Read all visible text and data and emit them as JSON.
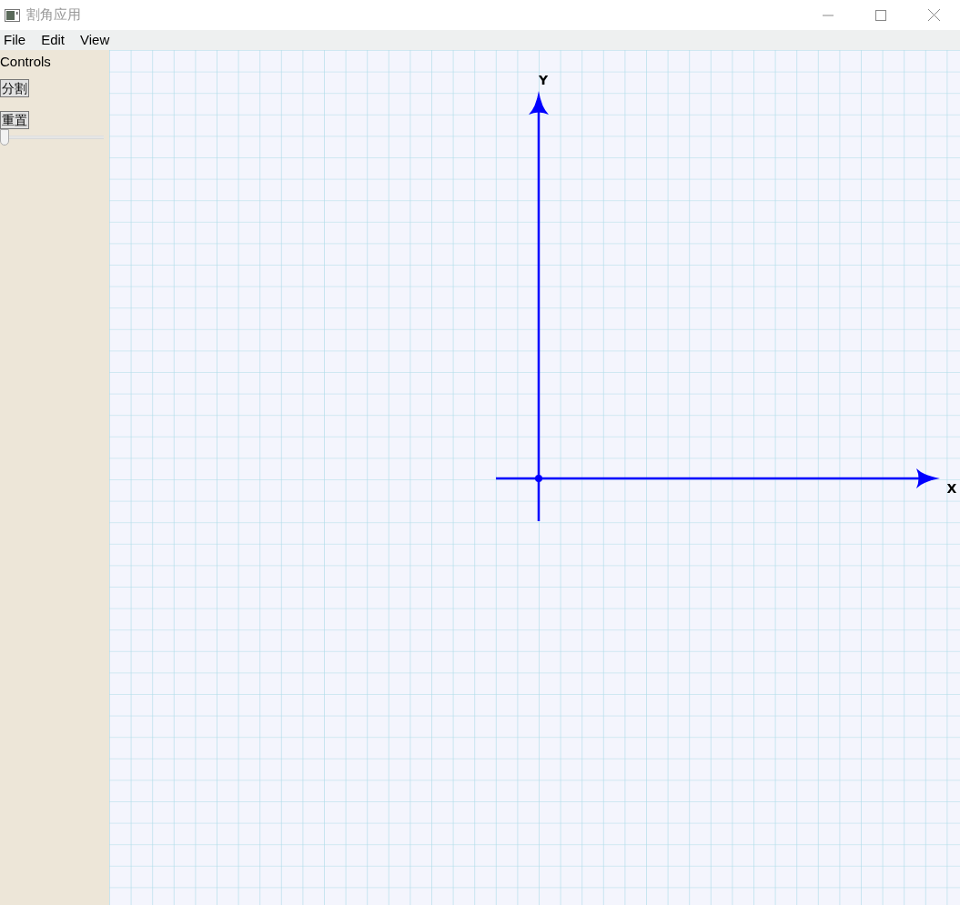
{
  "window": {
    "title": "割角应用"
  },
  "menu": [
    {
      "label": "File"
    },
    {
      "label": "Edit"
    },
    {
      "label": "View"
    }
  ],
  "sidebar": {
    "title": "Controls",
    "buttons": [
      {
        "label": "分割"
      },
      {
        "label": "重置"
      }
    ],
    "slider": {
      "level": 0
    }
  },
  "canvas": {
    "x_label": "X",
    "y_label": "Y"
  }
}
